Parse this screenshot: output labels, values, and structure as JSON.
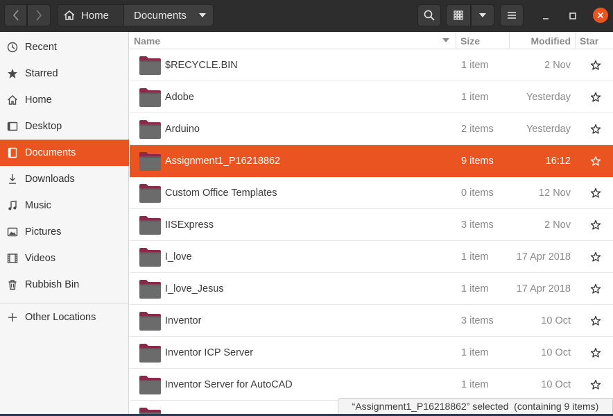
{
  "header": {
    "path": {
      "home_label": "Home",
      "current_label": "Documents"
    }
  },
  "sidebar": {
    "items": [
      {
        "label": "Recent",
        "icon": "clock-icon",
        "active": false
      },
      {
        "label": "Starred",
        "icon": "star-icon",
        "active": false
      },
      {
        "label": "Home",
        "icon": "home-icon",
        "active": false
      },
      {
        "label": "Desktop",
        "icon": "desktop-icon",
        "active": false
      },
      {
        "label": "Documents",
        "icon": "document-icon",
        "active": true
      },
      {
        "label": "Downloads",
        "icon": "download-icon",
        "active": false
      },
      {
        "label": "Music",
        "icon": "music-icon",
        "active": false
      },
      {
        "label": "Pictures",
        "icon": "picture-icon",
        "active": false
      },
      {
        "label": "Videos",
        "icon": "video-icon",
        "active": false
      },
      {
        "label": "Rubbish Bin",
        "icon": "trash-icon",
        "active": false
      }
    ],
    "other_locations": "Other Locations"
  },
  "columns": {
    "name": "Name",
    "size": "Size",
    "modified": "Modified",
    "star": "Star"
  },
  "files": [
    {
      "name": "$RECYCLE.BIN",
      "size": "1 item",
      "modified": "2 Nov",
      "selected": false
    },
    {
      "name": "Adobe",
      "size": "1 item",
      "modified": "Yesterday",
      "selected": false
    },
    {
      "name": "Arduino",
      "size": "2 items",
      "modified": "Yesterday",
      "selected": false
    },
    {
      "name": "Assignment1_P16218862",
      "size": "9 items",
      "modified": "16:12",
      "selected": true
    },
    {
      "name": "Custom Office Templates",
      "size": "0 items",
      "modified": "12 Nov",
      "selected": false
    },
    {
      "name": "IISExpress",
      "size": "3 items",
      "modified": "2 Nov",
      "selected": false
    },
    {
      "name": "I_love",
      "size": "1 item",
      "modified": "17 Apr 2018",
      "selected": false
    },
    {
      "name": "I_love_Jesus",
      "size": "1 item",
      "modified": "17 Apr 2018",
      "selected": false
    },
    {
      "name": "Inventor",
      "size": "3 items",
      "modified": "10 Oct",
      "selected": false
    },
    {
      "name": "Inventor ICP Server",
      "size": "1 item",
      "modified": "10 Oct",
      "selected": false
    },
    {
      "name": "Inventor Server for AutoCAD",
      "size": "1 item",
      "modified": "10 Oct",
      "selected": false
    },
    {
      "name": "",
      "size": "",
      "modified": "",
      "selected": false
    }
  ],
  "status": "“Assignment1_P16218862” selected  (containing 9 items)",
  "colors": {
    "accent": "#e95420",
    "headerbar": "#2d2d2d",
    "folder_body": "#6b6b6b",
    "folder_tab": "#8a2a4a"
  }
}
